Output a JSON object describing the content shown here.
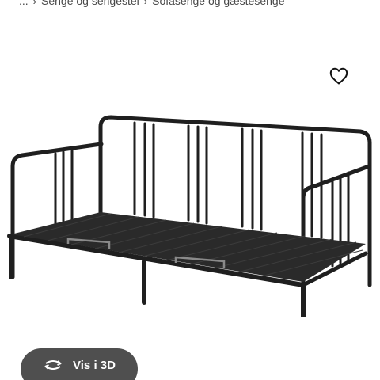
{
  "breadcrumb": {
    "ellipsis": "...",
    "items": [
      {
        "label": "Senge og sengestel"
      },
      {
        "label": "Sofasenge og gæstesenge"
      }
    ],
    "separator": "›"
  },
  "product": {
    "favorite_icon": "heart-outline-icon",
    "view_3d": {
      "label": "Vis i 3D",
      "icon": "rotate-3d-icon"
    }
  },
  "colors": {
    "frame": "#1f1f1f",
    "button_bg": "#4f4f4f",
    "button_text": "#ffffff"
  }
}
